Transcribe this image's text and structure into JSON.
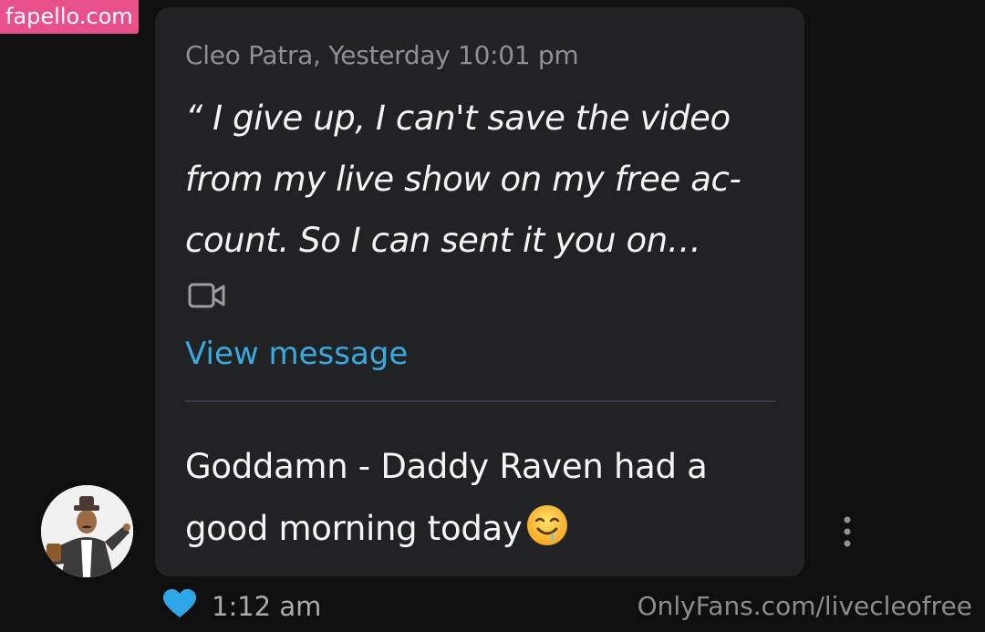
{
  "watermark_top": "fapello.com",
  "watermark_bottom": "OnlyFans.com/livecleofree",
  "quoted": {
    "meta": "Cleo Patra, Yesterday 10:01 pm",
    "text": "“ I give up, I can't save the video from my live show on my free ac-count. So I can sent it you on…",
    "link_label": "View message"
  },
  "message": {
    "text": "Goddamn - Daddy Raven had a good morning today",
    "emoji": "drooling-face"
  },
  "footer": {
    "time": "1:12 am",
    "liked": true
  },
  "colors": {
    "background": "#0f0f10",
    "bubble": "#202224",
    "link": "#3aa9e0",
    "heart": "#2ea6e8",
    "watermark_bg": "#e8508c"
  },
  "icons": [
    "video-icon",
    "heart-icon",
    "more-vertical-icon",
    "drooling-face-emoji"
  ]
}
